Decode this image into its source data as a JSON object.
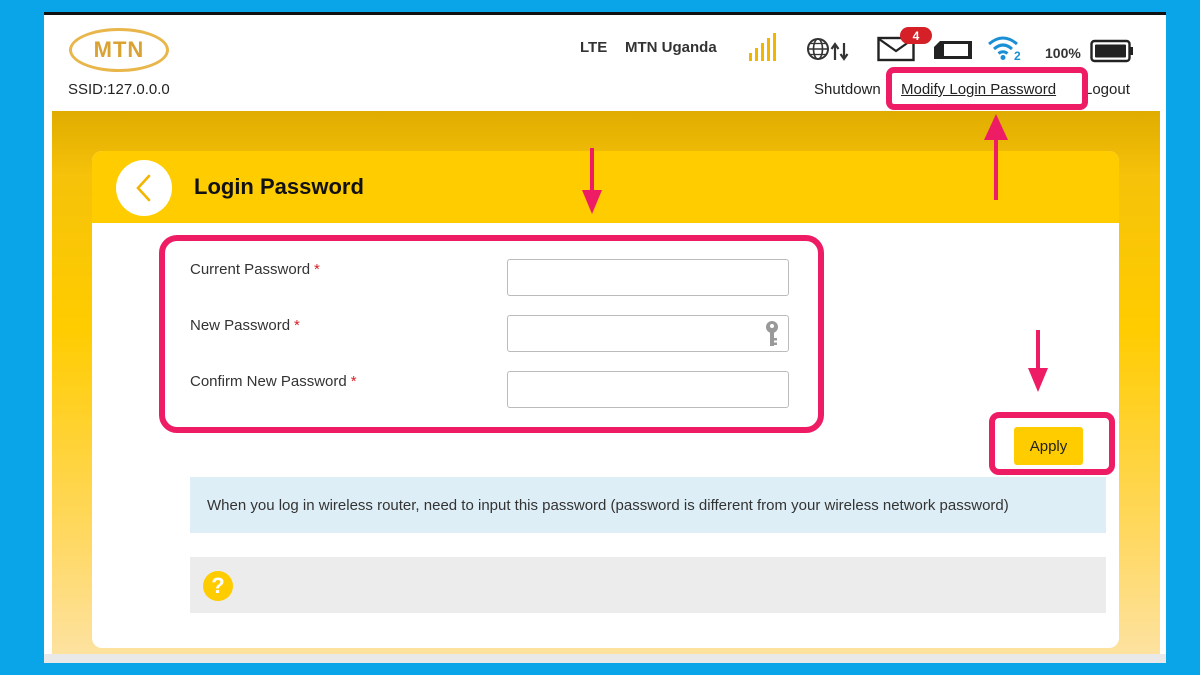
{
  "header": {
    "logo_text": "MTN",
    "ssid": "SSID:127.0.0.0",
    "network_type": "LTE",
    "carrier": "MTN Uganda",
    "unread_messages": "4",
    "wifi_clients": "2",
    "battery_percent": "100%",
    "signal_bars": 5
  },
  "top_links": {
    "shutdown": "Shutdown",
    "modify_login_password": "Modify Login Password",
    "logout": "Logout"
  },
  "card": {
    "title": "Login Password",
    "fields": [
      {
        "label": "Current Password",
        "required_mark": "*",
        "value": ""
      },
      {
        "label": "New Password",
        "required_mark": "*",
        "value": ""
      },
      {
        "label": "Confirm New Password",
        "required_mark": "*",
        "value": ""
      }
    ],
    "apply_label": "Apply",
    "info_text": "When you log in wireless router, need to input this password (password is different from your wireless network password)",
    "help_symbol": "?"
  },
  "icons": {
    "back": "back-arrow-icon",
    "signal": "signal-bars-icon",
    "globe": "globe-data-icon",
    "mail": "mail-icon",
    "sim": "sim-card-icon",
    "wifi": "wifi-icon",
    "battery": "battery-icon",
    "key": "key-icon",
    "help": "help-icon"
  },
  "colors": {
    "brand_yellow": "#ffcc00",
    "background_blue": "#0aa5e8",
    "annotation_pink": "#ee1c64",
    "badge_red": "#d62027"
  }
}
